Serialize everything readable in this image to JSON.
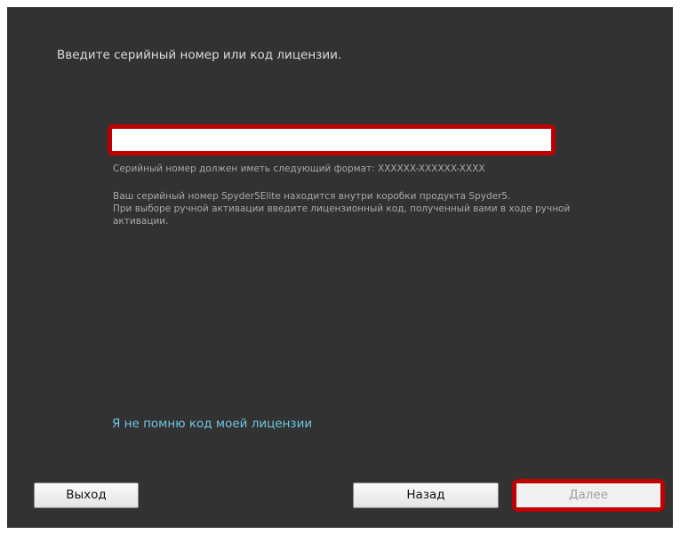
{
  "prompt": "Введите серийный номер или код лицензии.",
  "serial_input": {
    "value": "",
    "placeholder": ""
  },
  "format_hint": "Серийный номер должен иметь следующий формат: XXXXXX-XXXXXX-XXXX",
  "info_lines": [
    "Ваш серийный номер Spyder5Elite находится внутри коробки продукта Spyder5.",
    "При выборе ручной активации введите лицензионный код, полученный вами в ходе ручной активации."
  ],
  "forgot_link": "Я не помню код моей лицензии",
  "buttons": {
    "exit": "Выход",
    "back": "Назад",
    "next": "Далее"
  },
  "colors": {
    "background": "#323232",
    "highlight": "#c00000",
    "link": "#6ec6e6"
  }
}
